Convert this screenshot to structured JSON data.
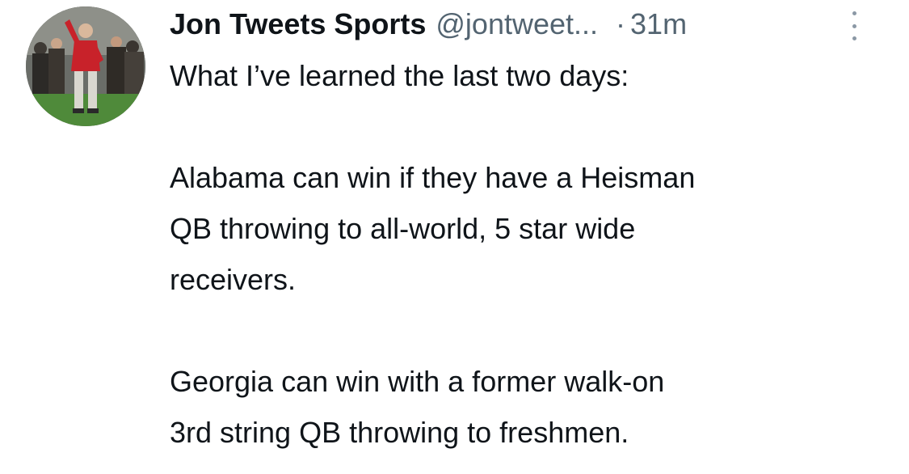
{
  "tweet": {
    "display_name": "Jon Tweets Sports",
    "handle": "@jontweet...",
    "separator": "·",
    "time": "31m",
    "avatar_icon": "profile-photo",
    "more_icon": "vertical-ellipsis-icon",
    "lines": [
      "What I’ve learned the last two days:",
      "Alabama can win if they have a Heisman",
      "QB throwing to all-world, 5 star wide",
      "receivers.",
      "Georgia can win with a former walk-on",
      "3rd string QB throwing to freshmen."
    ]
  },
  "colors": {
    "text": "#0f1419",
    "secondary": "#536471",
    "background": "#ffffff"
  }
}
